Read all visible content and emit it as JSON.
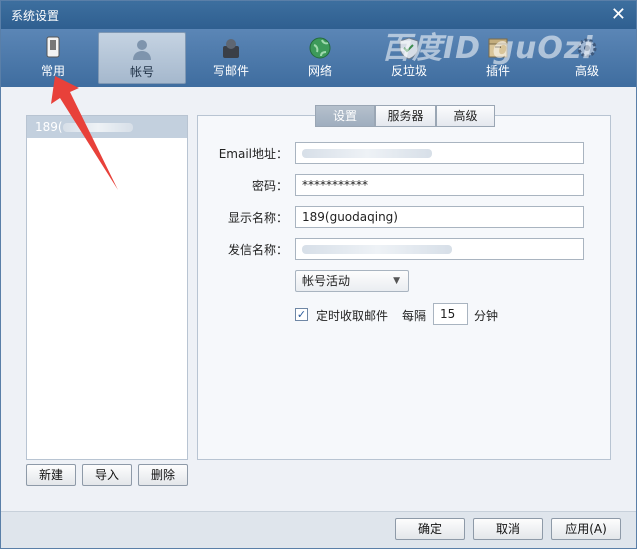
{
  "window": {
    "title": "系统设置",
    "watermark": "百度ID guOzi"
  },
  "toolbar": {
    "items": [
      {
        "label": "常用",
        "icon": "phone-icon"
      },
      {
        "label": "帐号",
        "icon": "person-icon"
      },
      {
        "label": "写邮件",
        "icon": "compose-icon"
      },
      {
        "label": "网络",
        "icon": "globe-icon"
      },
      {
        "label": "反垃圾",
        "icon": "shield-icon"
      },
      {
        "label": "插件",
        "icon": "plugin-icon"
      },
      {
        "label": "高级",
        "icon": "gear-icon"
      }
    ],
    "active_index": 1
  },
  "accounts": {
    "items": [
      {
        "label": "189("
      }
    ],
    "buttons": {
      "new": "新建",
      "import": "导入",
      "delete": "删除"
    }
  },
  "tabs": {
    "items": [
      "设置",
      "服务器",
      "高级"
    ],
    "active": "设置"
  },
  "form": {
    "email_label": "Email地址：",
    "password_label": "密码：",
    "password_value": "***********",
    "display_name_label": "显示名称：",
    "display_name_value": "189(guodaqing)",
    "sender_name_label": "发信名称：",
    "account_activity": "帐号活动",
    "auto_fetch_label": "定时收取邮件",
    "auto_fetch_checked": true,
    "interval_prefix": "每隔",
    "interval_value": "15",
    "interval_unit": "分钟"
  },
  "footer": {
    "ok": "确定",
    "cancel": "取消",
    "apply": "应用(A)"
  },
  "colors": {
    "title_bar": "#2f5f90",
    "toolbar": "#4a78a9",
    "arrow": "#e8413a"
  }
}
